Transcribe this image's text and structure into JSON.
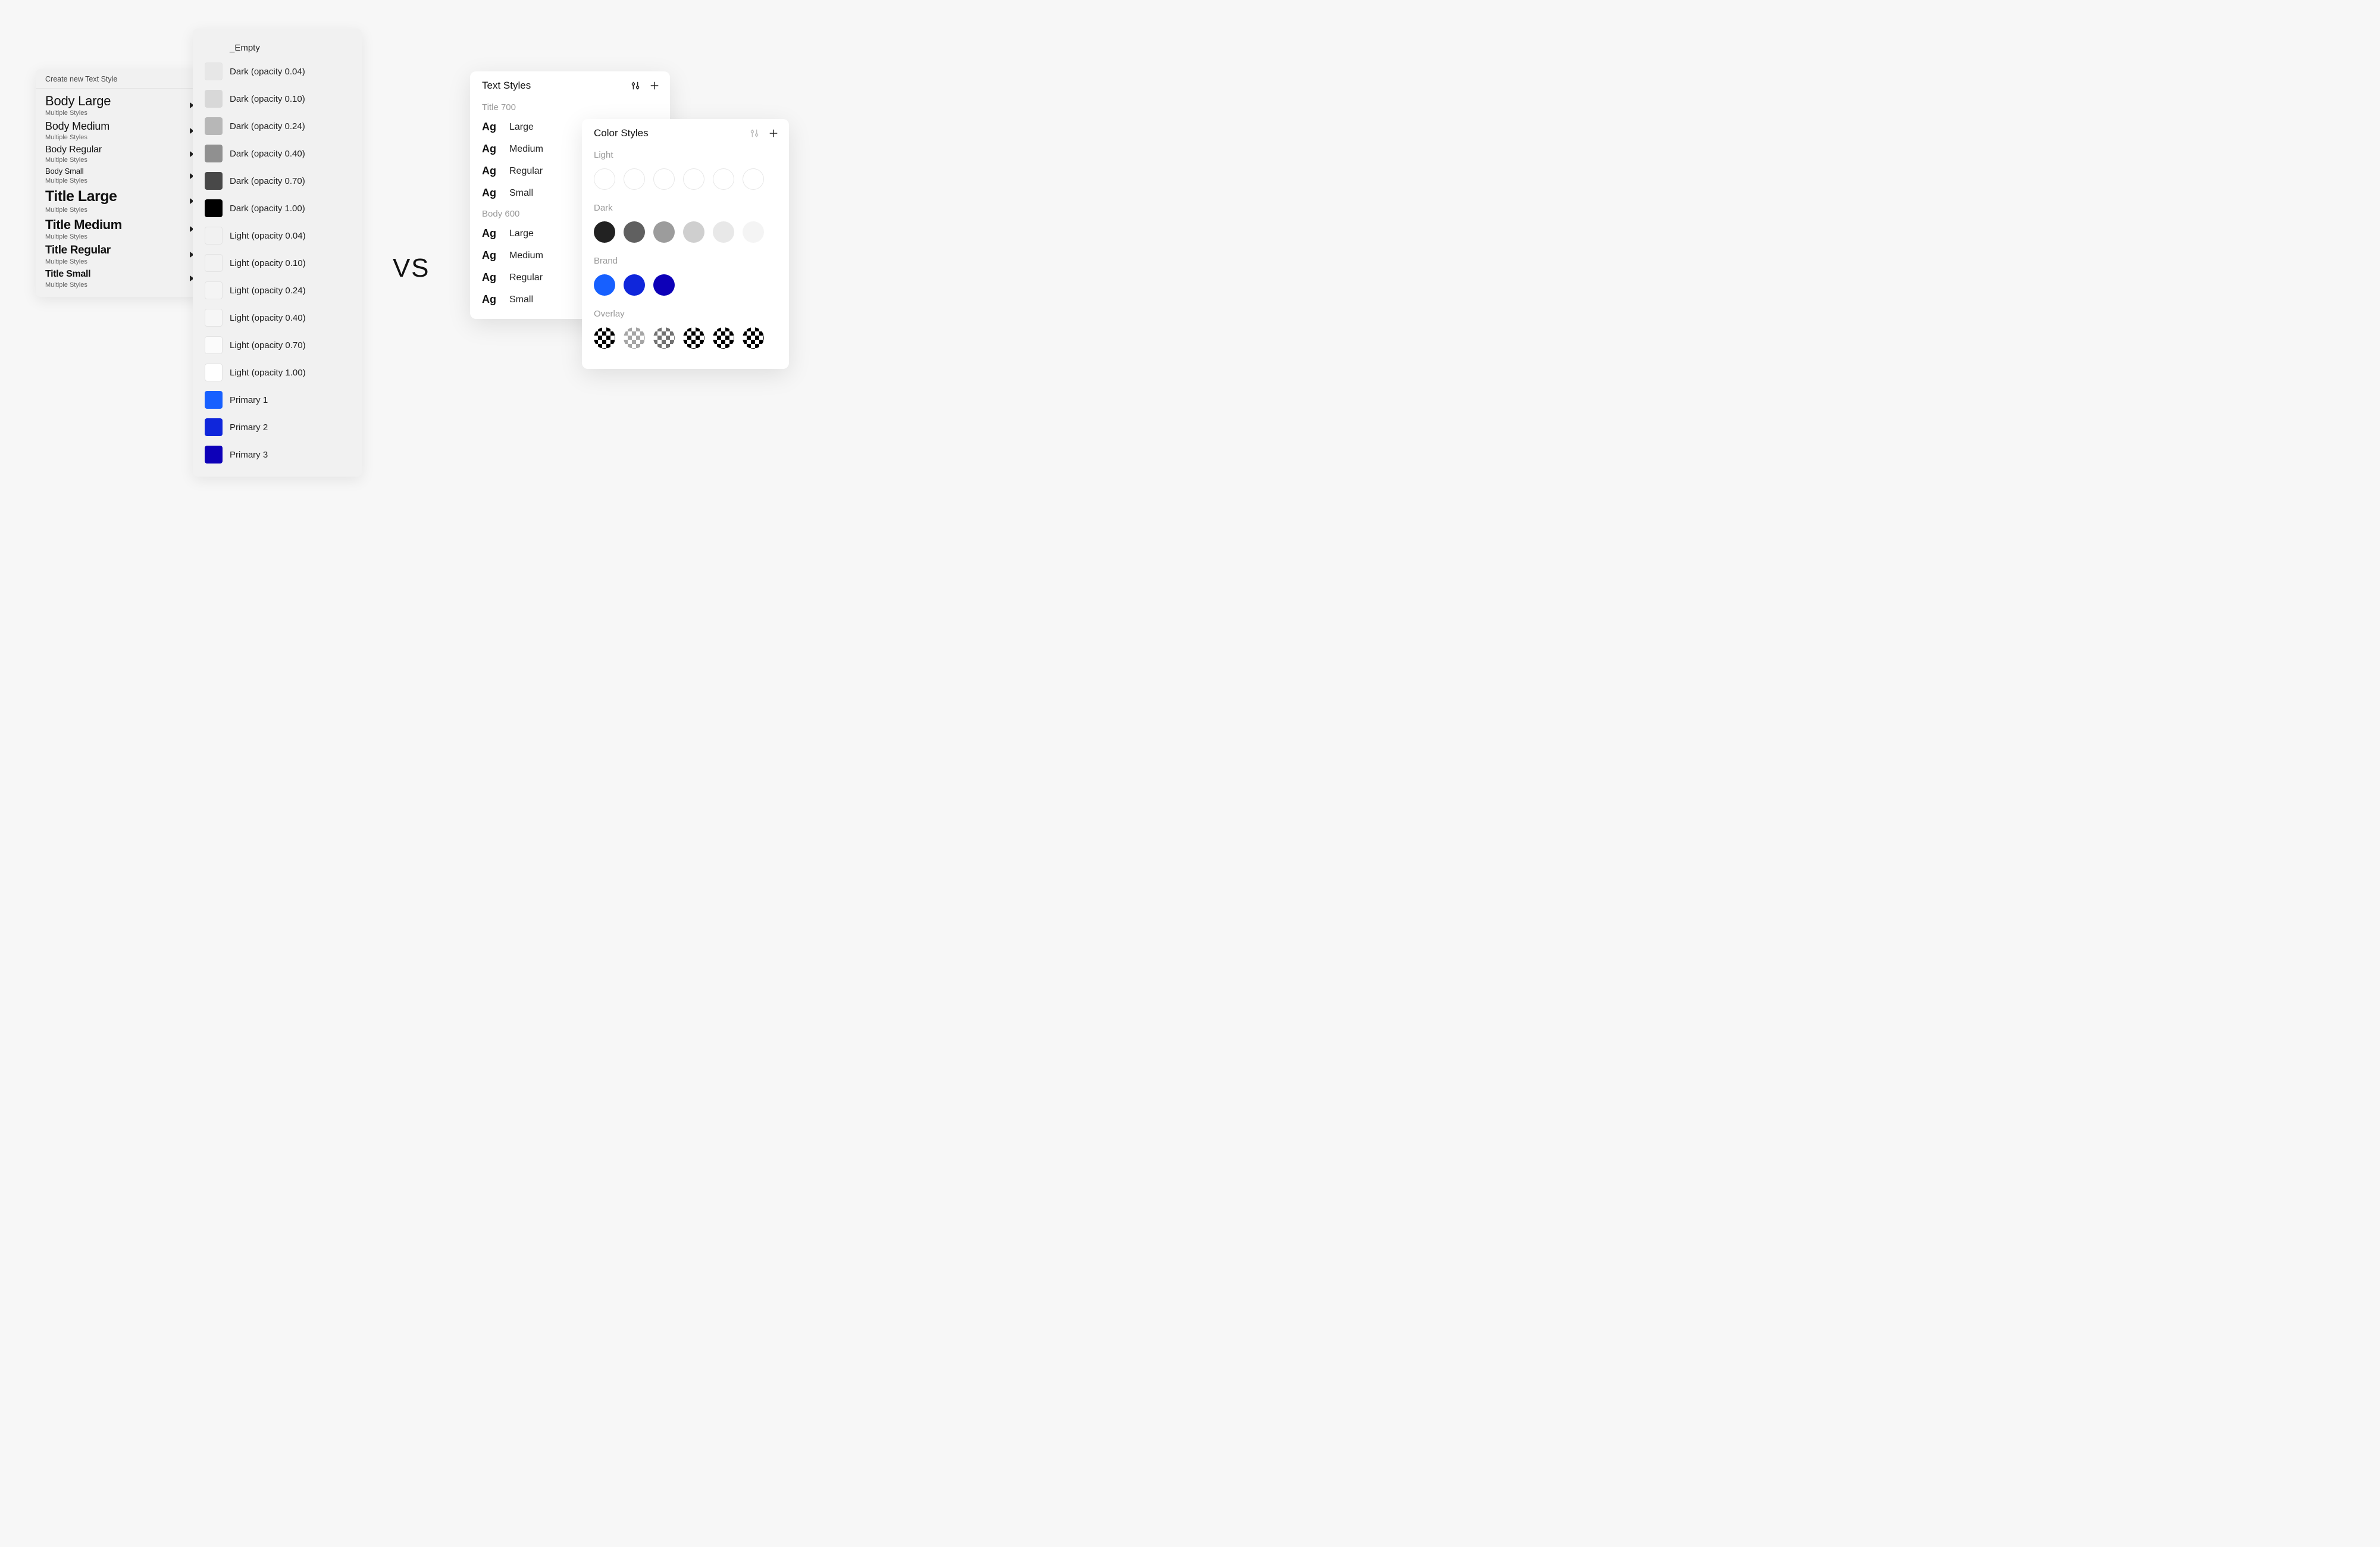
{
  "vs_label": "VS",
  "sketch_text_panel": {
    "header": "Create new Text Style",
    "sub_label": "Multiple Styles",
    "items": [
      {
        "name": "Body Large",
        "class": "fs-body-large"
      },
      {
        "name": "Body Medium",
        "class": "fs-body-medium"
      },
      {
        "name": "Body Regular",
        "class": "fs-body-regular"
      },
      {
        "name": "Body Small",
        "class": "fs-body-small"
      },
      {
        "name": "Title Large",
        "class": "fs-title-large"
      },
      {
        "name": "Title Medium",
        "class": "fs-title-medium"
      },
      {
        "name": "Title Regular",
        "class": "fs-title-regular"
      },
      {
        "name": "Title Small",
        "class": "fs-title-small"
      }
    ]
  },
  "sketch_color_panel": {
    "empty_label": "_Empty",
    "items": [
      {
        "label": "Dark (opacity 0.04)",
        "color": "rgba(0,0,0,0.04)",
        "border": true
      },
      {
        "label": "Dark (opacity 0.10)",
        "color": "rgba(0,0,0,0.10)",
        "border": false
      },
      {
        "label": "Dark (opacity 0.24)",
        "color": "rgba(0,0,0,0.24)",
        "border": false
      },
      {
        "label": "Dark (opacity 0.40)",
        "color": "rgba(0,0,0,0.40)",
        "border": false
      },
      {
        "label": "Dark (opacity 0.70)",
        "color": "rgba(0,0,0,0.70)",
        "border": false
      },
      {
        "label": "Dark (opacity 1.00)",
        "color": "rgba(0,0,0,1.00)",
        "border": false
      },
      {
        "label": "Light (opacity 0.04)",
        "color": "rgba(255,255,255,0.04)",
        "border": true
      },
      {
        "label": "Light (opacity 0.10)",
        "color": "rgba(255,255,255,0.10)",
        "border": true
      },
      {
        "label": "Light (opacity 0.24)",
        "color": "rgba(255,255,255,0.24)",
        "border": true
      },
      {
        "label": "Light (opacity 0.40)",
        "color": "rgba(255,255,255,0.40)",
        "border": true
      },
      {
        "label": "Light (opacity 0.70)",
        "color": "rgba(255,255,255,0.70)",
        "border": true
      },
      {
        "label": "Light (opacity 1.00)",
        "color": "rgba(255,255,255,1.00)",
        "border": true
      },
      {
        "label": "Primary 1",
        "color": "#1760ff",
        "border": false
      },
      {
        "label": "Primary 2",
        "color": "#0f26db",
        "border": false
      },
      {
        "label": "Primary 3",
        "color": "#0d00b8",
        "border": false
      }
    ]
  },
  "figma_text_panel": {
    "title": "Text Styles",
    "ag": "Ag",
    "groups": [
      {
        "label": "Title 700",
        "items": [
          "Large",
          "Medium",
          "Regular",
          "Small"
        ]
      },
      {
        "label": "Body 600",
        "items": [
          "Large",
          "Medium",
          "Regular",
          "Small"
        ]
      }
    ]
  },
  "figma_color_panel": {
    "title": "Color Styles",
    "groups": [
      {
        "label": "Light",
        "swatches": [
          {
            "color": "#ffffff",
            "ring": true
          },
          {
            "color": "#ffffff",
            "ring": true
          },
          {
            "color": "#ffffff",
            "ring": true
          },
          {
            "color": "#ffffff",
            "ring": true
          },
          {
            "color": "#ffffff",
            "ring": true
          },
          {
            "color": "#ffffff",
            "ring": true
          }
        ]
      },
      {
        "label": "Dark",
        "swatches": [
          {
            "color": "#222222"
          },
          {
            "color": "#606060"
          },
          {
            "color": "#9c9c9c"
          },
          {
            "color": "#cfcfcf"
          },
          {
            "color": "#e8e8e8"
          },
          {
            "color": "#f4f4f4"
          }
        ]
      },
      {
        "label": "Brand",
        "swatches": [
          {
            "color": "#1760ff"
          },
          {
            "color": "#0f26db"
          },
          {
            "color": "#0d00b8"
          }
        ]
      },
      {
        "label": "Overlay",
        "swatches": [
          {
            "checker": true,
            "opacity": 1.0
          },
          {
            "checker": true,
            "opacity": 0.35
          },
          {
            "checker": true,
            "opacity": 0.55
          },
          {
            "checker": true,
            "opacity": 1.0
          },
          {
            "checker": true,
            "opacity": 1.0
          },
          {
            "checker": true,
            "opacity": 1.0
          }
        ]
      }
    ]
  }
}
